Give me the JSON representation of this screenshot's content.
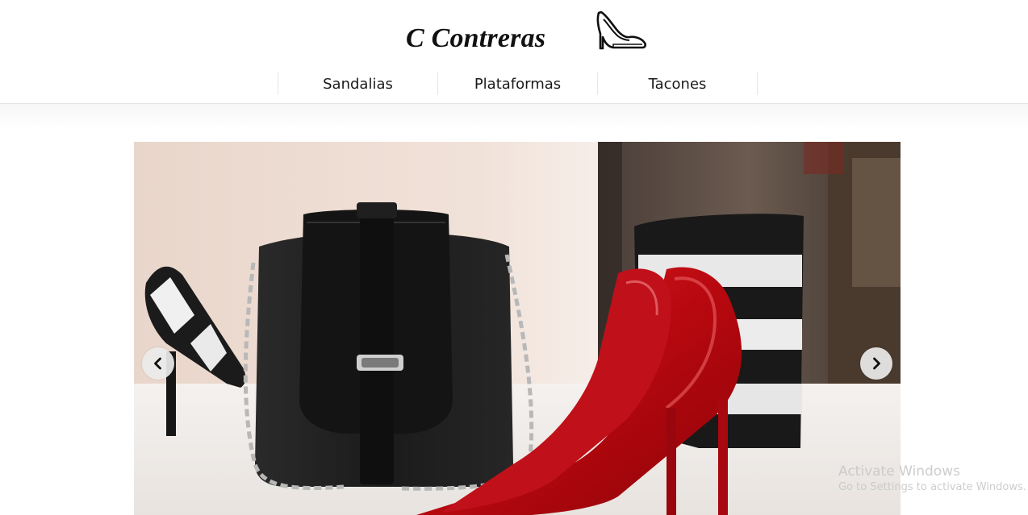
{
  "header": {
    "brand": "C Contreras",
    "brand_icon": "high-heel-shoe-icon"
  },
  "nav": {
    "items": [
      {
        "label": "Sandalias"
      },
      {
        "label": "Plataformas"
      },
      {
        "label": "Tacones"
      }
    ]
  },
  "slider": {
    "prev_icon": "chevron-left-icon",
    "next_icon": "chevron-right-icon",
    "image_subject": "black handbag with red and striped high heels"
  },
  "watermark": {
    "title": "Activate Windows",
    "subtitle": "Go to Settings to activate Windows."
  },
  "colors": {
    "background": "#ffffff",
    "text": "#111111",
    "shoe_red": "#c8141a",
    "bag_black": "#1a1a1a"
  }
}
